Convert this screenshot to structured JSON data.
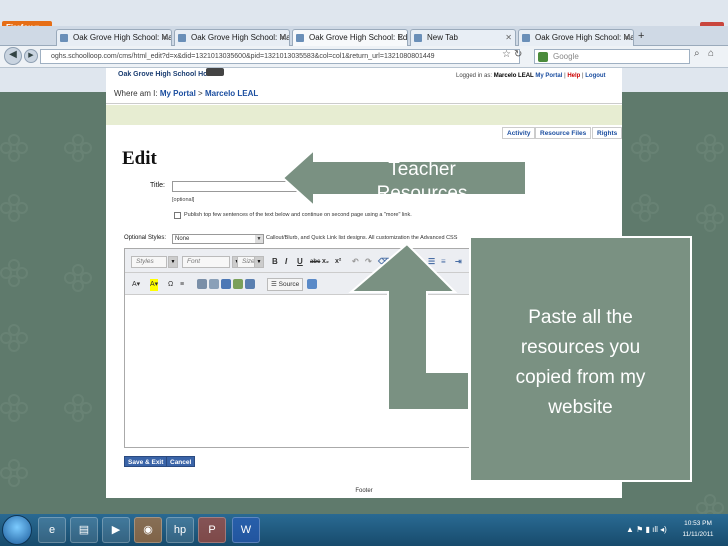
{
  "browser": {
    "app_button": "Firefox",
    "tabs": [
      {
        "label": "Oak Grove High School: Marcel..."
      },
      {
        "label": "Oak Grove High School: Marcel..."
      },
      {
        "label": "Oak Grove High School: Edit"
      },
      {
        "label": "New Tab"
      },
      {
        "label": "Oak Grove High School: Marcel..."
      }
    ],
    "url": "oghs.schoolloop.com/cms/html_edit?d=x&did=1321013035600&pid=1321013035583&col=col1&return_url=1321080801449",
    "search_placeholder": "Google"
  },
  "site": {
    "school_name": "Oak Grove High School Home",
    "logged_in_label": "Logged in as:",
    "user_name": "Marcelo LEAL",
    "my_portal": "My Portal",
    "help": "Help",
    "logout": "Logout",
    "where_am_i_label": "Where am I:",
    "breadcrumb_1": "My Portal",
    "breadcrumb_2": "Marcelo LEAL",
    "top_buttons": [
      "Activity",
      "Resource Files",
      "Rights"
    ]
  },
  "editor": {
    "page_title": "Edit",
    "title_label": "Title:",
    "optional_note": "[optional]",
    "publish_checkbox_label": "Publish top few sentences of the text below and continue on second page using a \"more\" link.",
    "optional_styles_label": "Optional Styles:",
    "optional_styles_value": "None",
    "optional_styles_note": "Callout/Blurb, and Quick Link list designs. All customization the Advanced CSS",
    "toolbar_styles": "Styles",
    "toolbar_font": "Font",
    "toolbar_size": "Size",
    "source_button": "Source",
    "save_exit": "Save & Exit",
    "cancel": "Cancel",
    "footer": "Footer"
  },
  "annotations": {
    "arrow_text": "Teacher Resources",
    "box_text": "Paste all the resources you copied from my website"
  },
  "taskbar": {
    "time": "10:53 PM",
    "date": "11/11/2011"
  }
}
